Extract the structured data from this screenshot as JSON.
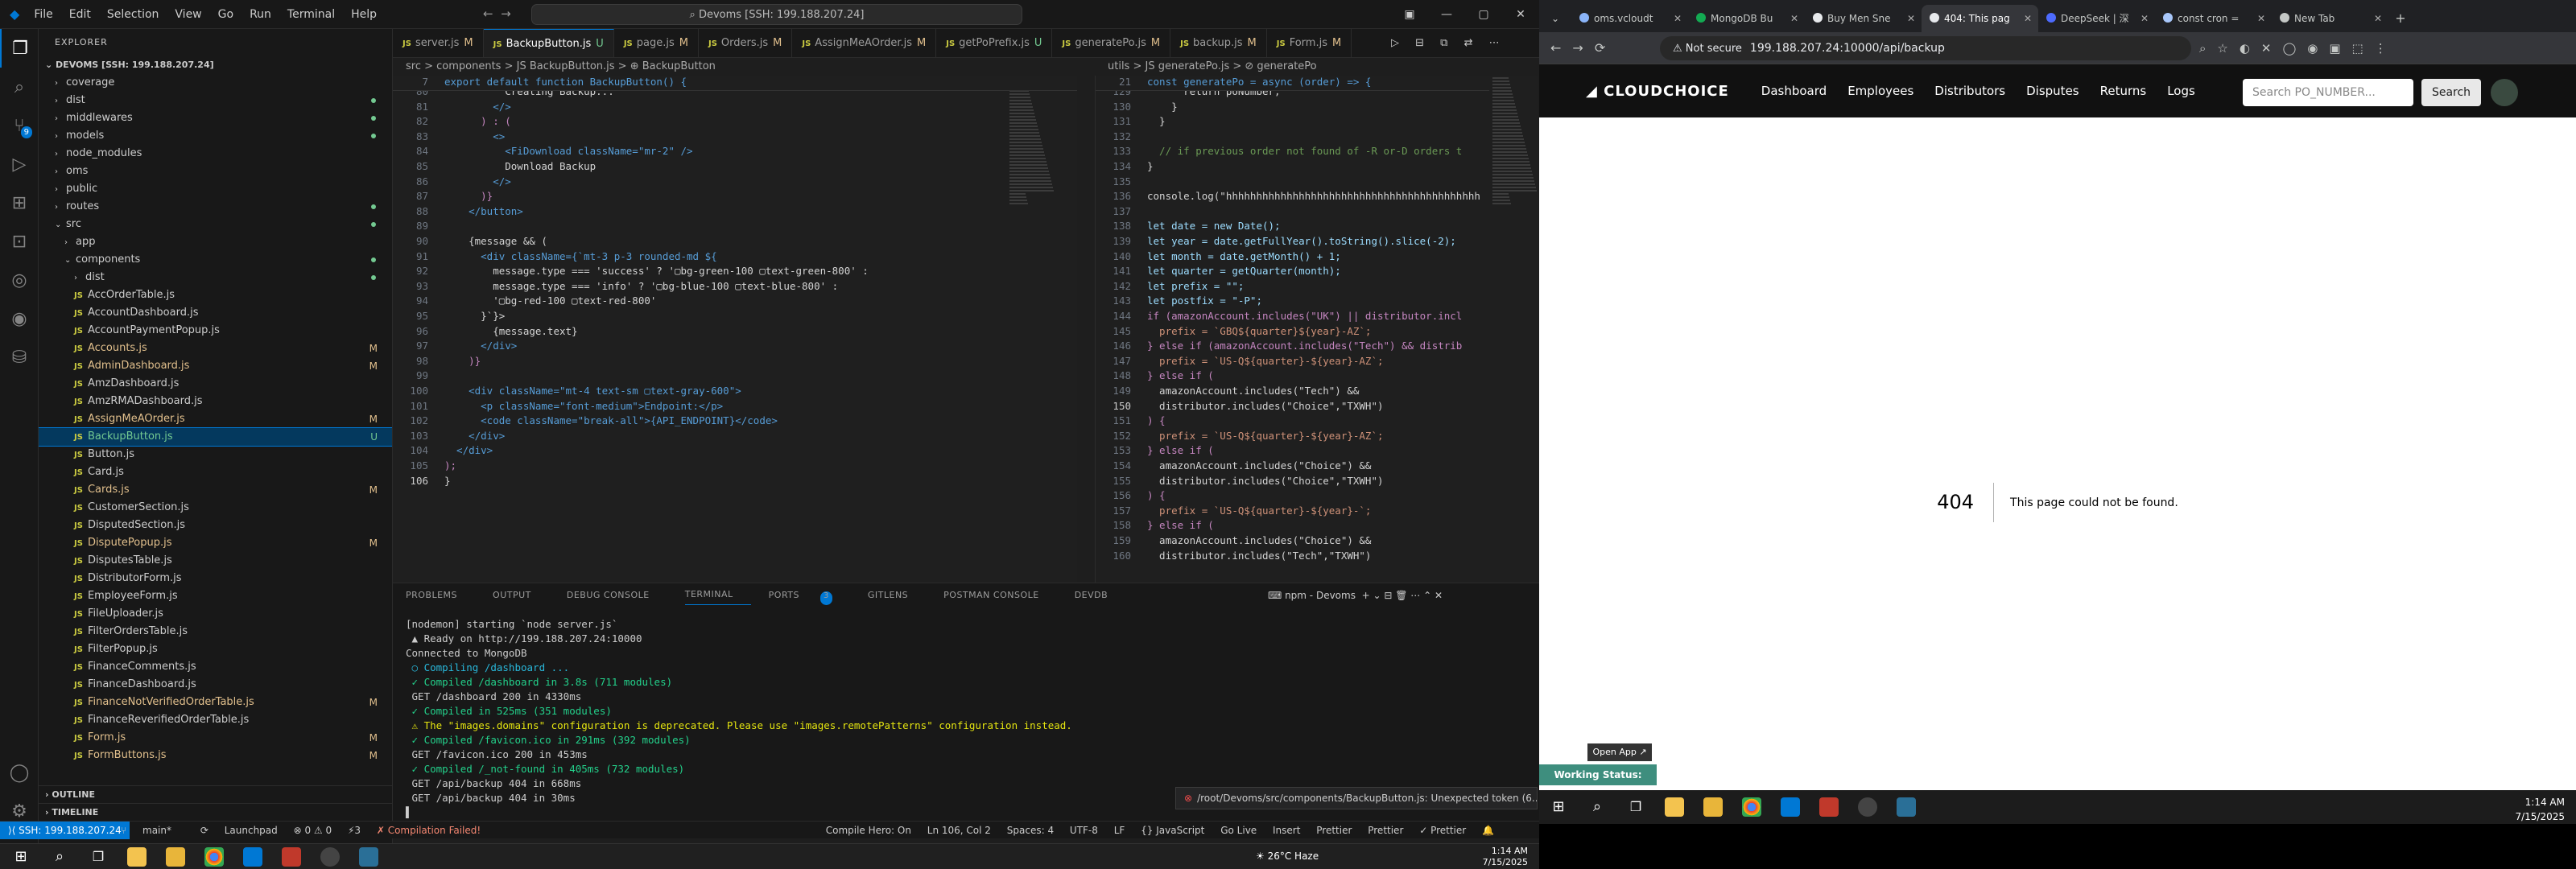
{
  "vscode": {
    "menu": [
      "File",
      "Edit",
      "Selection",
      "View",
      "Go",
      "Run",
      "Terminal",
      "Help"
    ],
    "command_center": "Devoms [SSH: 199.188.207.24]",
    "explorer_title": "EXPLORER",
    "root_folder": "DEVOMS [SSH: 199.188.207.24]",
    "tree": [
      {
        "label": "coverage",
        "type": "folder",
        "depth": 1
      },
      {
        "label": "dist",
        "type": "folder",
        "depth": 1
      },
      {
        "label": "middlewares",
        "type": "folder",
        "depth": 1
      },
      {
        "label": "models",
        "type": "folder",
        "depth": 1
      },
      {
        "label": "node_modules",
        "type": "folder",
        "depth": 1
      },
      {
        "label": "oms",
        "type": "folder",
        "depth": 1
      },
      {
        "label": "public",
        "type": "folder",
        "depth": 1
      },
      {
        "label": "routes",
        "type": "folder",
        "depth": 1
      },
      {
        "label": "src",
        "type": "folder-open",
        "depth": 1
      },
      {
        "label": "app",
        "type": "folder",
        "depth": 2
      },
      {
        "label": "components",
        "type": "folder-open",
        "depth": 2
      },
      {
        "label": "dist",
        "type": "folder",
        "depth": 3
      },
      {
        "label": "AccOrderTable.js",
        "type": "js",
        "depth": 3,
        "status": ""
      },
      {
        "label": "AccountDashboard.js",
        "type": "js",
        "depth": 3,
        "status": ""
      },
      {
        "label": "AccountPaymentPopup.js",
        "type": "js",
        "depth": 3,
        "status": ""
      },
      {
        "label": "Accounts.js",
        "type": "js",
        "depth": 3,
        "status": "M"
      },
      {
        "label": "AdminDashboard.js",
        "type": "js",
        "depth": 3,
        "status": "M"
      },
      {
        "label": "AmzDashboard.js",
        "type": "js",
        "depth": 3,
        "status": ""
      },
      {
        "label": "AmzRMADashboard.js",
        "type": "js",
        "depth": 3,
        "status": ""
      },
      {
        "label": "AssignMeAOrder.js",
        "type": "js",
        "depth": 3,
        "status": "M"
      },
      {
        "label": "BackupButton.js",
        "type": "js",
        "depth": 3,
        "status": "U",
        "selected": true
      },
      {
        "label": "Button.js",
        "type": "js",
        "depth": 3,
        "status": ""
      },
      {
        "label": "Card.js",
        "type": "js",
        "depth": 3,
        "status": ""
      },
      {
        "label": "Cards.js",
        "type": "js",
        "depth": 3,
        "status": "M"
      },
      {
        "label": "CustomerSection.js",
        "type": "js",
        "depth": 3,
        "status": ""
      },
      {
        "label": "DisputedSection.js",
        "type": "js",
        "depth": 3,
        "status": ""
      },
      {
        "label": "DisputePopup.js",
        "type": "js",
        "depth": 3,
        "status": "M"
      },
      {
        "label": "DisputesTable.js",
        "type": "js",
        "depth": 3,
        "status": ""
      },
      {
        "label": "DistributorForm.js",
        "type": "js",
        "depth": 3,
        "status": ""
      },
      {
        "label": "EmployeeForm.js",
        "type": "js",
        "depth": 3,
        "status": ""
      },
      {
        "label": "FileUploader.js",
        "type": "js",
        "depth": 3,
        "status": ""
      },
      {
        "label": "FilterOrdersTable.js",
        "type": "js",
        "depth": 3,
        "status": ""
      },
      {
        "label": "FilterPopup.js",
        "type": "js",
        "depth": 3,
        "status": ""
      },
      {
        "label": "FinanceComments.js",
        "type": "js",
        "depth": 3,
        "status": ""
      },
      {
        "label": "FinanceDashboard.js",
        "type": "js",
        "depth": 3,
        "status": ""
      },
      {
        "label": "FinanceNotVerifiedOrderTable.js",
        "type": "js",
        "depth": 3,
        "status": "M"
      },
      {
        "label": "FinanceReverifiedOrderTable.js",
        "type": "js",
        "depth": 3,
        "status": ""
      },
      {
        "label": "Form.js",
        "type": "js",
        "depth": 3,
        "status": "M"
      },
      {
        "label": "FormButtons.js",
        "type": "js",
        "depth": 3,
        "status": "M"
      }
    ],
    "outline_label": "OUTLINE",
    "timeline_label": "TIMELINE",
    "tabs": [
      {
        "label": "server.js",
        "mod": "M",
        "active": false
      },
      {
        "label": "BackupButton.js",
        "mod": "U",
        "active": true
      },
      {
        "label": "page.js",
        "mod": "M",
        "active": false
      },
      {
        "label": "Orders.js",
        "mod": "M",
        "active": false
      },
      {
        "label": "AssignMeAOrder.js",
        "mod": "M",
        "active": false
      },
      {
        "label": "getPoPrefix.js",
        "mod": "U",
        "active": false
      },
      {
        "label": "generatePo.js",
        "mod": "M",
        "active": false
      },
      {
        "label": "backup.js",
        "mod": "M",
        "active": false
      },
      {
        "label": "Form.js",
        "mod": "M",
        "active": false
      }
    ],
    "left_crumbs": "src > components > JS BackupButton.js > ⊕ BackupButton",
    "left_sticky_ln": "7",
    "left_sticky": "export default function BackupButton() {",
    "left_lines_start": 80,
    "left_lines": [
      "          Creating Backup...",
      "        </>",
      "      ) : (",
      "        <>",
      "          <FiDownload className=\"mr-2\" />",
      "          Download Backup",
      "        </>",
      "      )}",
      "    </button>",
      "",
      "    {message && (",
      "      <div className={`mt-3 p-3 rounded-md ${",
      "        message.type === 'success' ? '▢bg-green-100 ▢text-green-800' :",
      "        message.type === 'info' ? '▢bg-blue-100 ▢text-blue-800' :",
      "        '▢bg-red-100 ▢text-red-800'",
      "      }`}>",
      "        {message.text}",
      "      </div>",
      "    )}",
      "",
      "    <div className=\"mt-4 text-sm ▢text-gray-600\">",
      "      <p className=\"font-medium\">Endpoint:</p>",
      "      <code className=\"break-all\">{API_ENDPOINT}</code>",
      "    </div>",
      "  </div>",
      ");",
      "}"
    ],
    "right_crumbs": "utils > JS generatePo.js > ⊘ generatePo",
    "right_sticky_ln": "21",
    "right_sticky": "const generatePo = async (order) => {",
    "right_lines_start": 129,
    "right_lines": [
      "      return poNumber;",
      "    }",
      "  }",
      "",
      "  // if previous order not found of -R or-D orders t",
      "}",
      "",
      "console.log(\"hhhhhhhhhhhhhhhhhhhhhhhhhhhhhhhhhhhhhhhhhh",
      "",
      "let date = new Date();",
      "let year = date.getFullYear().toString().slice(-2);",
      "let month = date.getMonth() + 1;",
      "let quarter = getQuarter(month);",
      "let prefix = \"\";",
      "let postfix = \"-P\";",
      "if (amazonAccount.includes(\"UK\") || distributor.incl",
      "  prefix = `GBQ${quarter}${year}-AZ`;",
      "} else if (amazonAccount.includes(\"Tech\") && distrib",
      "  prefix = `US-Q${quarter}-${year}-AZ`;",
      "} else if (",
      "  amazonAccount.includes(\"Tech\") &&",
      "  distributor.includes(\"Choice\",\"TXWH\")",
      ") {",
      "  prefix = `US-Q${quarter}-${year}-AZ`;",
      "} else if (",
      "  amazonAccount.includes(\"Choice\") &&",
      "  distributor.includes(\"Choice\",\"TXWH\")",
      ") {",
      "  prefix = `US-Q${quarter}-${year}-`;",
      "} else if (",
      "  amazonAccount.includes(\"Choice\") &&",
      "  distributor.includes(\"Tech\",\"TXWH\")"
    ],
    "panel_tabs": [
      "PROBLEMS",
      "OUTPUT",
      "DEBUG CONSOLE",
      "TERMINAL",
      "PORTS",
      "GITLENS",
      "POSTMAN CONSOLE",
      "DEVDB"
    ],
    "ports_count": "3",
    "terminal_selector": "npm - Devoms",
    "terminal_lines": [
      "[nodemon] starting `node server.js`",
      " ▲ Ready on http://199.188.207.24:10000",
      "Connected to MongoDB",
      " ○ Compiling /dashboard ...",
      " ✓ Compiled /dashboard in 3.8s (711 modules)",
      " GET /dashboard 200 in 4330ms",
      " ✓ Compiled in 525ms (351 modules)",
      " ⚠ The \"images.domains\" configuration is deprecated. Please use \"images.remotePatterns\" configuration instead.",
      " ✓ Compiled /favicon.ico in 291ms (392 modules)",
      " GET /favicon.ico 200 in 453ms",
      " ✓ Compiled /_not-found in 405ms (732 modules)",
      " GET /api/backup 404 in 668ms",
      " GET /api/backup 404 in 30ms",
      "▌"
    ],
    "toast": "/root/Devoms/src/components/BackupButton.js: Unexpected token (6...",
    "status": {
      "remote": "⟩⟨ SSH: 199.188.207.24",
      "branch": "main*",
      "sync": "⟳",
      "launchpad": "Launchpad",
      "errors": "⊗ 0 ⚠ 0",
      "ports": "⚡3",
      "compile": "✗ Compilation Failed!",
      "compile_hero": "Compile Hero: On",
      "position": "Ln 106, Col 2",
      "spaces": "Spaces: 4",
      "encoding": "UTF-8",
      "eol": "LF",
      "language": "{} JavaScript",
      "golive": "Go Live",
      "insert": "Insert",
      "prettier1": "Prettier",
      "prettier2": "Prettier",
      "prettier3": "✓ Prettier"
    },
    "taskbar": {
      "weather": "26°C  Haze",
      "time": "1:14 AM",
      "date": "7/15/2025"
    }
  },
  "browser": {
    "tabs": [
      {
        "label": "oms.vcloudt",
        "color": "#8ab4f8"
      },
      {
        "label": "MongoDB Bu",
        "color": "#13aa52"
      },
      {
        "label": "Buy Men Sne",
        "color": "#e8eaed"
      },
      {
        "label": "404: This pag",
        "color": "#e8eaed",
        "active": true
      },
      {
        "label": "DeepSeek | 深",
        "color": "#4d6bfe"
      },
      {
        "label": "const cron =",
        "color": "#a8c7fa"
      },
      {
        "label": "New Tab",
        "color": "#c4c7c5"
      }
    ],
    "not_secure": "⚠ Not secure",
    "url": "199.188.207.24:10000/api/backup",
    "site": {
      "logo": "CLOUDCHOICE",
      "nav": [
        "Dashboard",
        "Employees",
        "Distributors",
        "Disputes",
        "Returns",
        "Logs"
      ],
      "search_placeholder": "Search PO_NUMBER...",
      "search_button": "Search"
    },
    "error_code": "404",
    "error_message": "This page could not be found.",
    "open_app": "Open App ↗",
    "working_status": "Working Status: Active",
    "taskbar": {
      "time": "1:14 AM",
      "date": "7/15/2025"
    }
  }
}
